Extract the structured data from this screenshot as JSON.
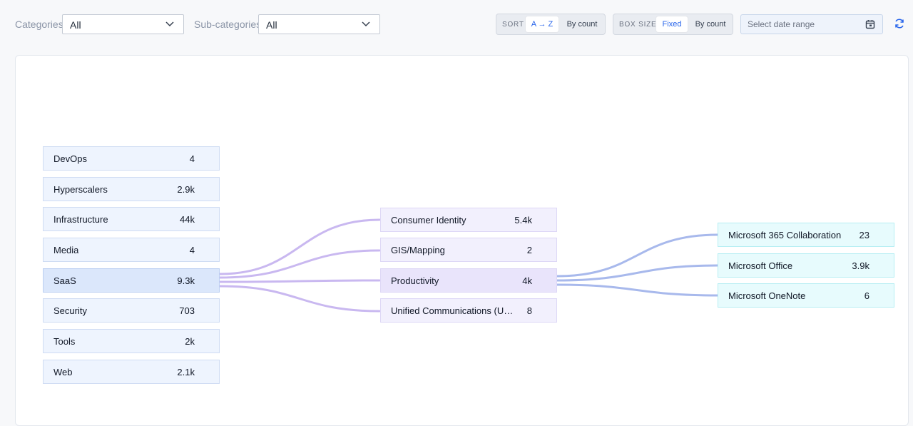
{
  "filters": {
    "categories_label": "Categories",
    "categories_value": "All",
    "subcategories_label": "Sub-categories",
    "subcategories_value": "All"
  },
  "sort": {
    "caption": "SORT",
    "options": [
      "A → Z",
      "By count"
    ],
    "active": "A → Z"
  },
  "box_size": {
    "caption": "BOX SIZE",
    "options": [
      "Fixed",
      "By count"
    ],
    "active": "Fixed"
  },
  "date_range": {
    "placeholder": "Select date range"
  },
  "categories": [
    {
      "name": "DevOps",
      "count": "4"
    },
    {
      "name": "Hyperscalers",
      "count": "2.9k"
    },
    {
      "name": "Infrastructure",
      "count": "44k"
    },
    {
      "name": "Media",
      "count": "4"
    },
    {
      "name": "SaaS",
      "count": "9.3k",
      "selected": true
    },
    {
      "name": "Security",
      "count": "703"
    },
    {
      "name": "Tools",
      "count": "2k"
    },
    {
      "name": "Web",
      "count": "2.1k"
    }
  ],
  "subcategories": [
    {
      "name": "Consumer Identity",
      "count": "5.4k"
    },
    {
      "name": "GIS/Mapping",
      "count": "2"
    },
    {
      "name": "Productivity",
      "count": "4k",
      "selected": true
    },
    {
      "name": "Unified Communications (UCa...",
      "count": "8"
    }
  ],
  "products": [
    {
      "name": "Microsoft 365 Collaboration",
      "count": "23"
    },
    {
      "name": "Microsoft Office",
      "count": "3.9k"
    },
    {
      "name": "Microsoft OneNote",
      "count": "6"
    }
  ],
  "colors": {
    "link_left": "#c9b8f0",
    "link_right": "#a8b9ec",
    "accent": "#2563eb"
  }
}
